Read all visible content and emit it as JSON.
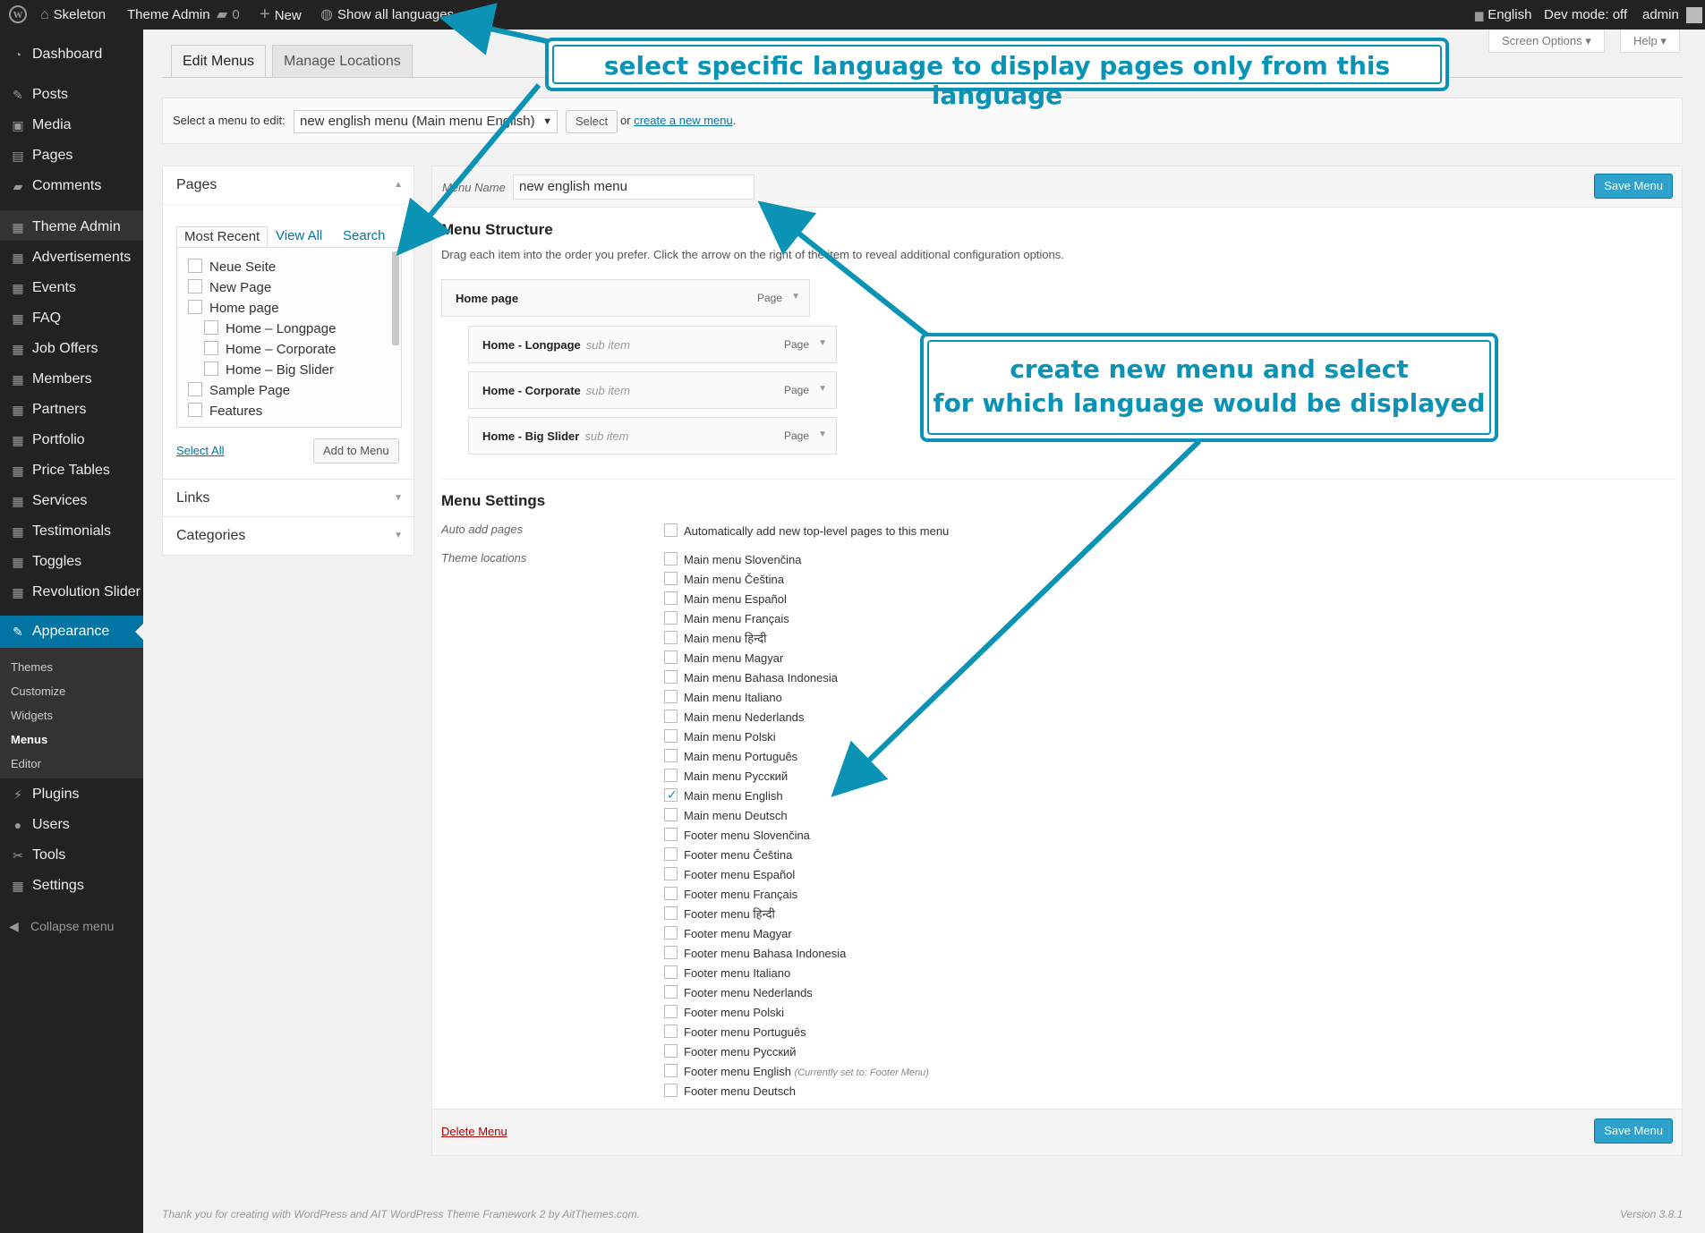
{
  "adminbar": {
    "site_name": "Skeleton",
    "theme_admin": "Theme Admin",
    "comments_count": "0",
    "new_label": "New",
    "languages_label": "Show all languages",
    "current_lang": "English",
    "dev_mode": "Dev mode: off",
    "user": "admin"
  },
  "sidebar": {
    "items": [
      {
        "label": "Dashboard",
        "icon": "dashboard-icon"
      },
      {
        "label": "Posts",
        "icon": "pin-icon"
      },
      {
        "label": "Media",
        "icon": "media-icon"
      },
      {
        "label": "Pages",
        "icon": "pages-icon"
      },
      {
        "label": "Comments",
        "icon": "comments-icon"
      },
      {
        "label": "Theme Admin",
        "icon": "theme-admin-icon"
      },
      {
        "label": "Advertisements",
        "icon": "ads-icon"
      },
      {
        "label": "Events",
        "icon": "events-icon"
      },
      {
        "label": "FAQ",
        "icon": "faq-icon"
      },
      {
        "label": "Job Offers",
        "icon": "jobs-icon"
      },
      {
        "label": "Members",
        "icon": "members-icon"
      },
      {
        "label": "Partners",
        "icon": "partners-icon"
      },
      {
        "label": "Portfolio",
        "icon": "portfolio-icon"
      },
      {
        "label": "Price Tables",
        "icon": "price-icon"
      },
      {
        "label": "Services",
        "icon": "services-icon"
      },
      {
        "label": "Testimonials",
        "icon": "testimonials-icon"
      },
      {
        "label": "Toggles",
        "icon": "toggles-icon"
      },
      {
        "label": "Revolution Slider",
        "icon": "slider-icon"
      }
    ],
    "appearance": "Appearance",
    "submenu": [
      "Themes",
      "Customize",
      "Widgets",
      "Menus",
      "Editor"
    ],
    "bottom": [
      {
        "label": "Plugins",
        "icon": "plugins-icon"
      },
      {
        "label": "Users",
        "icon": "users-icon"
      },
      {
        "label": "Tools",
        "icon": "tools-icon"
      },
      {
        "label": "Settings",
        "icon": "settings-icon"
      }
    ],
    "collapse": "Collapse menu"
  },
  "top_buttons": {
    "screen_options": "Screen Options ▾",
    "help": "Help ▾"
  },
  "tabs": [
    "Edit Menus",
    "Manage Locations"
  ],
  "manage": {
    "label": "Select a menu to edit:",
    "selected": "new english menu (Main menu English)",
    "select_btn": "Select",
    "or": "or",
    "create_link": "create a new menu",
    "period": "."
  },
  "pages_box": {
    "title": "Pages",
    "tabs": [
      "Most Recent",
      "View All",
      "Search"
    ],
    "items": [
      {
        "label": "Neue Seite",
        "level": 0
      },
      {
        "label": "New Page",
        "level": 0
      },
      {
        "label": "Home page",
        "level": 0
      },
      {
        "label": "Home – Longpage",
        "level": 1
      },
      {
        "label": "Home – Corporate",
        "level": 1
      },
      {
        "label": "Home – Big Slider",
        "level": 1
      },
      {
        "label": "Sample Page",
        "level": 0
      },
      {
        "label": "Features",
        "level": 0
      }
    ],
    "select_all": "Select All",
    "add_btn": "Add to Menu"
  },
  "links_box": {
    "title": "Links"
  },
  "categories_box": {
    "title": "Categories"
  },
  "menu_panel": {
    "name_label": "Menu Name",
    "name_value": "new english menu",
    "save_btn": "Save Menu",
    "structure_title": "Menu Structure",
    "structure_desc": "Drag each item into the order you prefer. Click the arrow on the right of the item to reveal additional configuration options.",
    "items": [
      {
        "title": "Home page",
        "sub": "",
        "type": "Page"
      },
      {
        "title": "Home - Longpage",
        "sub": "sub item",
        "type": "Page"
      },
      {
        "title": "Home - Corporate",
        "sub": "sub item",
        "type": "Page"
      },
      {
        "title": "Home - Big Slider",
        "sub": "sub item",
        "type": "Page"
      }
    ],
    "settings_title": "Menu Settings",
    "auto_add_label": "Auto add pages",
    "auto_add_text": "Automatically add new top-level pages to this menu",
    "locations_label": "Theme locations",
    "locations": [
      {
        "label": "Main menu Slovenčina",
        "checked": false,
        "note": ""
      },
      {
        "label": "Main menu Čeština",
        "checked": false,
        "note": ""
      },
      {
        "label": "Main menu Español",
        "checked": false,
        "note": ""
      },
      {
        "label": "Main menu Français",
        "checked": false,
        "note": ""
      },
      {
        "label": "Main menu हिन्दी",
        "checked": false,
        "note": ""
      },
      {
        "label": "Main menu Magyar",
        "checked": false,
        "note": ""
      },
      {
        "label": "Main menu Bahasa Indonesia",
        "checked": false,
        "note": ""
      },
      {
        "label": "Main menu Italiano",
        "checked": false,
        "note": ""
      },
      {
        "label": "Main menu Nederlands",
        "checked": false,
        "note": ""
      },
      {
        "label": "Main menu Polski",
        "checked": false,
        "note": ""
      },
      {
        "label": "Main menu Português",
        "checked": false,
        "note": ""
      },
      {
        "label": "Main menu Русский",
        "checked": false,
        "note": ""
      },
      {
        "label": "Main menu English",
        "checked": true,
        "note": ""
      },
      {
        "label": "Main menu Deutsch",
        "checked": false,
        "note": ""
      },
      {
        "label": "Footer menu Slovenčina",
        "checked": false,
        "note": ""
      },
      {
        "label": "Footer menu Čeština",
        "checked": false,
        "note": ""
      },
      {
        "label": "Footer menu Español",
        "checked": false,
        "note": ""
      },
      {
        "label": "Footer menu Français",
        "checked": false,
        "note": ""
      },
      {
        "label": "Footer menu हिन्दी",
        "checked": false,
        "note": ""
      },
      {
        "label": "Footer menu Magyar",
        "checked": false,
        "note": ""
      },
      {
        "label": "Footer menu Bahasa Indonesia",
        "checked": false,
        "note": ""
      },
      {
        "label": "Footer menu Italiano",
        "checked": false,
        "note": ""
      },
      {
        "label": "Footer menu Nederlands",
        "checked": false,
        "note": ""
      },
      {
        "label": "Footer menu Polski",
        "checked": false,
        "note": ""
      },
      {
        "label": "Footer menu Português",
        "checked": false,
        "note": ""
      },
      {
        "label": "Footer menu Русский",
        "checked": false,
        "note": ""
      },
      {
        "label": "Footer menu English",
        "checked": false,
        "note": "(Currently set to: Footer Menu)"
      },
      {
        "label": "Footer menu Deutsch",
        "checked": false,
        "note": ""
      }
    ],
    "delete_link": "Delete Menu"
  },
  "footer": {
    "thanks": "Thank you for creating with WordPress and AIT WordPress Theme Framework 2 by AitThemes.com.",
    "version": "Version 3.8.1"
  },
  "annotations": {
    "top": "select specific language to display pages only from this language",
    "middle_line1": "create new menu and select",
    "middle_line2": "for which language would be displayed"
  },
  "colors": {
    "accent": "#0074a2",
    "annotation": "#0a93b5",
    "sidebar": "#222222"
  }
}
